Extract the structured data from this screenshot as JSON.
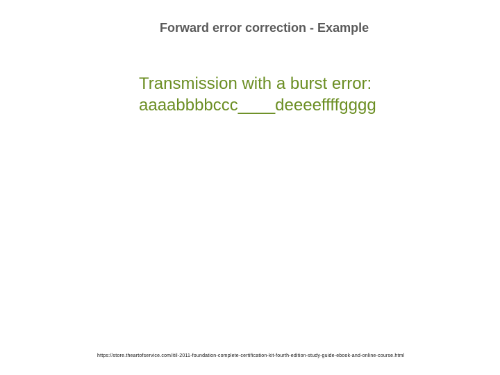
{
  "title": "Forward error correction - Example",
  "body": {
    "line1": "Transmission with a burst error:",
    "line2": "aaaabbbbccc____deeeeffffgggg"
  },
  "footer_url": "https://store.theartofservice.com/itil-2011-foundation-complete-certification-kit-fourth-edition-study-guide-ebook-and-online-course.html"
}
